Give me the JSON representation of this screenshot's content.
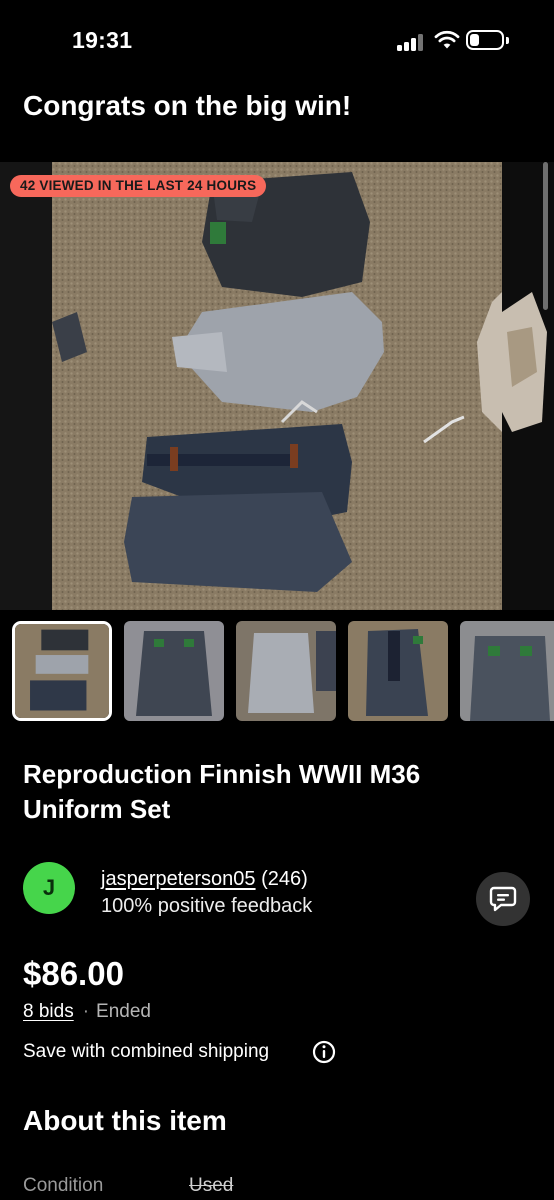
{
  "status_bar": {
    "time": "19:31",
    "battery_icon": "battery-icon",
    "wifi_icon": "wifi-icon",
    "signal_icon": "signal-icon"
  },
  "header": {
    "title": "Congrats on the big win!"
  },
  "gallery": {
    "viewed_badge": "42 VIEWED IN THE LAST 24 HOURS",
    "badge_color": "#f7685b",
    "thumbnail_count": 5,
    "selected_index": 0
  },
  "listing": {
    "title": "Reproduction Finnish WWII M36 Uniform Set",
    "price": "$86.00",
    "bids": "8 bids",
    "separator": "·",
    "status": "Ended",
    "shipping_note": "Save with combined shipping"
  },
  "seller": {
    "avatar_letter": "J",
    "avatar_color": "#46d54b",
    "name": "jasperpeterson05",
    "score": "(246)",
    "feedback": "100% positive feedback"
  },
  "about": {
    "heading": "About this item",
    "condition_label": "Condition",
    "condition_value": "Used"
  }
}
